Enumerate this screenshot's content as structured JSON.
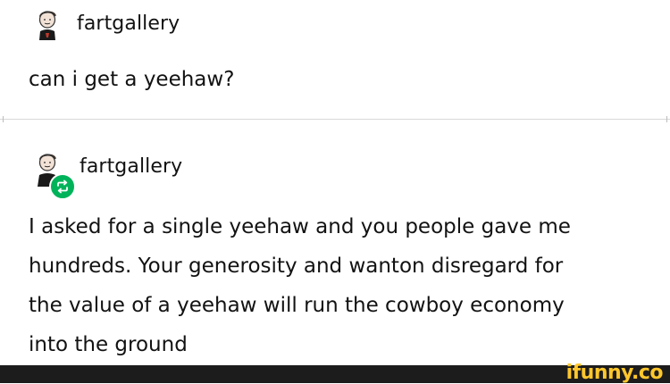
{
  "post1": {
    "username": "fartgallery",
    "text": "can i get a yeehaw?"
  },
  "post2": {
    "username": "fartgallery",
    "text_lines": [
      "I asked for a single yeehaw and you people gave me",
      "hundreds. Your generosity and wanton disregard for",
      "the value of a yeehaw will run the cowboy economy",
      "into the ground"
    ]
  },
  "footer": {
    "watermark": "ifunny.co"
  },
  "colors": {
    "reblog_badge": "#00b35a",
    "footer_bg": "#1c1c1c",
    "watermark": "#ffc72c"
  },
  "icons": {
    "avatar": "avatar-icon",
    "reblog": "reblog-icon"
  }
}
